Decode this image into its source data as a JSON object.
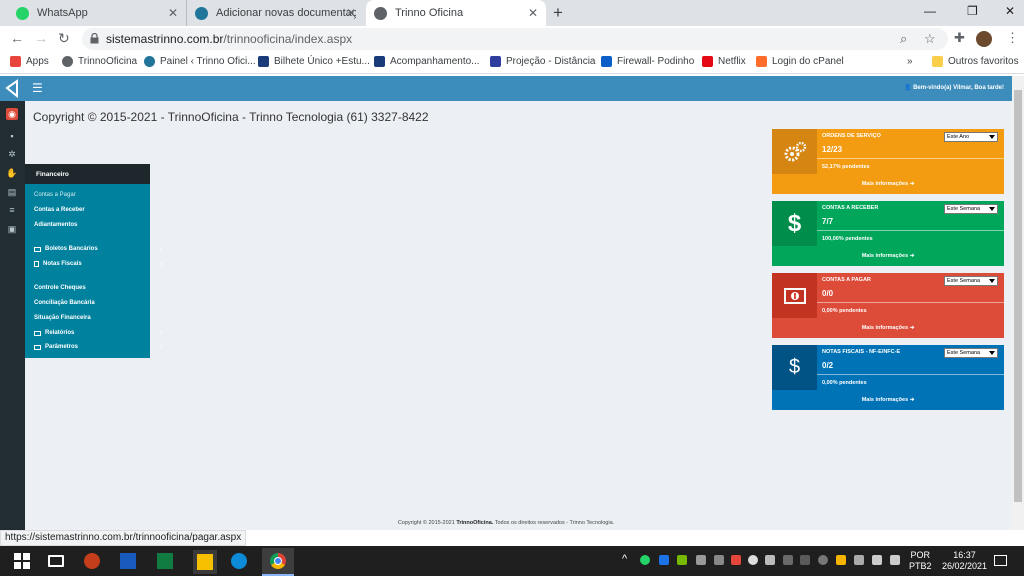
{
  "browser": {
    "tabs": [
      {
        "title": "WhatsApp"
      },
      {
        "title": "Adicionar novas documentações"
      },
      {
        "title": "Trinno Oficina"
      }
    ],
    "url_host": "sistemastrinno.com.br",
    "url_path": "/trinnooficina/index.aspx",
    "bookmarks": [
      {
        "label": "Apps",
        "color": "#e8453c"
      },
      {
        "label": "TrinnoOficina",
        "color": "#5f6368"
      },
      {
        "label": "Painel ‹ Trinno Ofici...",
        "color": "#21759b"
      },
      {
        "label": "Bilhete Único +Estu...",
        "color": "#1a3b7a"
      },
      {
        "label": "Acompanhamento...",
        "color": "#1a3b7a"
      },
      {
        "label": "Projeção - Distância",
        "color": "#2f3e9e"
      },
      {
        "label": "Firewall- Podinho",
        "color": "#0b5fc7"
      },
      {
        "label": "Netflix",
        "color": "#e50914"
      },
      {
        "label": "Login do cPanel",
        "color": "#ff6c2c"
      }
    ],
    "more_bookmarks": "»",
    "other_favorites": "Outros favoritos",
    "status_url": "https://sistemastrinno.com.br/trinnooficina/pagar.aspx"
  },
  "header": {
    "menu_icon": "☰",
    "welcome": "Bem-vindo(a) Vilmar, Boa tarde!",
    "copyright": "Copyright © 2015-2021 - TrinnoOficina - Trinno Tecnologia (61) 3327-8422"
  },
  "menu": {
    "title": "Financeiro",
    "items": [
      {
        "label": "Contas a Pagar"
      },
      {
        "label": "Contas a Receber"
      },
      {
        "label": "Adiantamentos"
      },
      {
        "label": "Boletos Bancários"
      },
      {
        "label": "Notas Fiscais"
      },
      {
        "label": "Controle Cheques"
      },
      {
        "label": "Conciliação Bancária"
      },
      {
        "label": "Situação Financeira"
      },
      {
        "label": "Relatórios"
      },
      {
        "label": "Parâmetros"
      }
    ]
  },
  "cards": [
    {
      "label": "ORDENS DE SERVIÇO",
      "value": "12/23",
      "pct": "52,17% pendentes",
      "period": "Este Ano",
      "more": "Mais informações",
      "icon": "gears-icon",
      "color": "#f39c12",
      "dark": "#d58512"
    },
    {
      "label": "CONTAS A RECEBER",
      "value": "7/7",
      "pct": "100,00% pendentes",
      "period": "Este Semana",
      "more": "Mais informações",
      "icon": "dollar-icon",
      "color": "#00a65a",
      "dark": "#008d4c"
    },
    {
      "label": "CONTAS A PAGAR",
      "value": "0/0",
      "pct": "0,00% pendentes",
      "period": "Este Semana",
      "more": "Mais informações",
      "icon": "money-icon",
      "color": "#dd4b39",
      "dark": "#c23321"
    },
    {
      "label": "NOTAS FISCAIS - NF-E/NFC-E",
      "value": "0/2",
      "pct": "0,00% pendentes",
      "period": "Este Semana",
      "more": "Mais informações",
      "icon": "dollar-icon",
      "color": "#0073b7",
      "dark": "#005384"
    }
  ],
  "footer": {
    "prefix": "Copyright © 2015-2021",
    "brand": "TrinnoOficina.",
    "suffix": "Todos os direitos reservados - Trinno Tecnologia."
  },
  "taskbar": {
    "language": "POR",
    "layout": "PTB2",
    "time": "16:37",
    "date": "26/02/2021"
  }
}
